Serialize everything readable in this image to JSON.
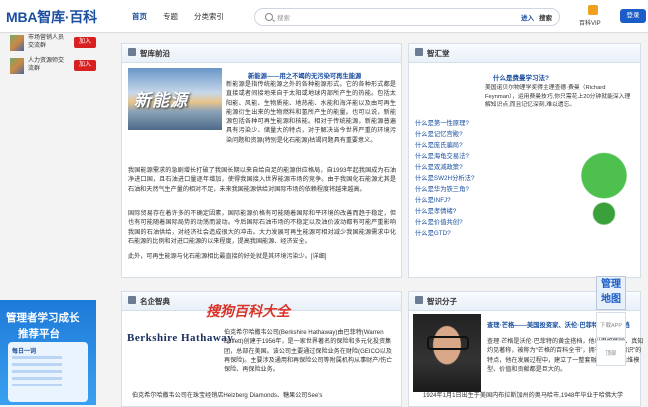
{
  "header": {
    "logo": "MBA智库·百科",
    "nav": [
      "首页",
      "专题",
      "分类索引"
    ],
    "search_placeholder": "搜索",
    "enter_label": "进入",
    "search_label": "搜索",
    "vip_label": "百科VIP",
    "login_label": "登录"
  },
  "sidebar": {
    "ads": [
      {
        "text": "市场营销人员交流群",
        "button": "加入"
      },
      {
        "text": "人力资源师交流群",
        "button": "加入"
      }
    ],
    "promo": {
      "line1": "管理者学习成长",
      "line2": "推荐平台",
      "card_title": "每日一词"
    }
  },
  "panels": {
    "smart_frontier": {
      "title": "智库前沿",
      "image_text": "新能源",
      "article_title": "新能源——用之不竭的无污染可再生能源",
      "para1": "新能源是指传统能源之外的各种能源形式。它的各种形式都是直接或者间接地来自于太阳或地球内部所产生的热能。包括太阳能、风能、生物质能、地热能、水能和海洋能以及由可再生能源衍生出来的生物燃料和氢所产生的能量。也可以说，新能源包括各种可再生能源和核能。相对于传统能源，新能源普遍具有污染少、储量大的特点，对于解决当今世界严重的环境污染问题和资源(特别是化石能源)枯竭问题具有重要意义。",
      "para2": "我国能源需求的急剧增长打破了我国长期以来自给自足的能源供应格局，自1993年起我国成为石油净进口国，且石油进口量逐年增加，使得我国接入世界能源市场的竞争。由于我国化石能源尤其是石油和天然气生产量的相对不足，未来我国能源供给对国际市场的依赖程度将越来越高。",
      "para3": "国际贸易存在着许多的不确定因素，国际能源价格有可能随着国际和平环境的改善而趋于稳定，但也有可能随着国际局势的动荡而波动。今后国际石油市场的不稳定以及油价波动都有可能严重影响我国的石油供给，对经济社会造成很大的冲击。大力发展可再生能源可相对减少我国能源需求中化石能源的比例和对进口能源的以来程度，提高我国能源、经济安全。",
      "para4": "此外，可再生能源与化石能源相比最直接的好处就是其环境污染少。[详细]"
    },
    "wisdom_hall": {
      "title": "智汇堂",
      "question": "什么是费曼学习法?",
      "desc": "美国诺贝尔物理学奖得主理查德·费曼（Richard Feynman），运用费曼技巧,你只需花上20分钟就能深入理解知识点,而且记忆深刻,难以遗忘。",
      "links": [
        "什么是第一性原理?",
        "什么是记忆宫殿?",
        "什么是庞氏骗局?",
        "什么是海龟交易法?",
        "什么是双减政策?",
        "什么是SW2H分析法?",
        "什么是华为铁三角?",
        "什么是INFJ?",
        "什么是孝情绪?",
        "什么是价值共创?",
        "什么是GTD?"
      ]
    },
    "famous_brand": {
      "title": "名企智典",
      "logo_text": "Berkshire Hathaway",
      "watermark": "搜狗百科大全",
      "desc": "伯克希尔哈撒韦公司(Berkshire Hathaway)由巴菲特(Warren Buffett)创建于1956年，是一家世界著名的保险和多元化投资集团，总部在美国。该公司主要通过保险业务在财险(GEICO以及再保险)。主要涉及通用和再保险公司等附属机构从事财产/伤亡保险、再保险业务。",
      "line": "伯克希尔哈撒韦公司在珠宝经销店Helzberg Diamonds、糖果公司See's"
    },
    "smart_people": {
      "title": "智识分子",
      "person_title": "查理·芒格——美国投资家、沃伦·巴菲特的黄金搭档",
      "desc": "查理·芒格是沃伦·巴菲特的黄金搭档，他以思维敏锐、真知灼见著称，被称为“芒格的百科全书”，拥有“跨学科知识”的特点，他在发展过程中，建立了一整套融会贯通的思维模型、价值和贡献都是巨大的。",
      "bottom_line": "1924年1月1日出生于美国内布拉斯加州的奥马哈市,1948年毕业于哈佛大学"
    }
  },
  "floating": {
    "manage_label": "管理地图",
    "tool1": "下载APP",
    "tool2": "顶部"
  }
}
